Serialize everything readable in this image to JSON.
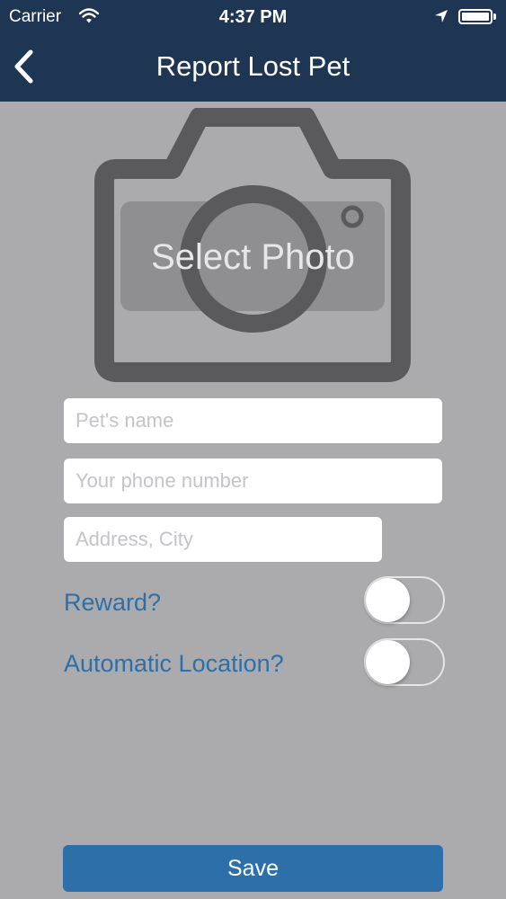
{
  "status_bar": {
    "carrier": "Carrier",
    "time": "4:37 PM"
  },
  "nav": {
    "title": "Report Lost Pet",
    "back_icon": "chevron-left-icon"
  },
  "photo": {
    "label": "Select Photo",
    "icon": "camera-icon"
  },
  "form": {
    "pet_name_placeholder": "Pet's name",
    "phone_placeholder": "Your phone number",
    "address_placeholder": "Address, City"
  },
  "toggles": {
    "reward_label": "Reward?",
    "reward_on": false,
    "auto_location_label": "Automatic Location?",
    "auto_location_on": false
  },
  "actions": {
    "save_label": "Save"
  },
  "colors": {
    "header_bg": "#1f3554",
    "body_bg": "#ababad",
    "accent": "#2d6fa8",
    "camera_stroke": "#5a595c",
    "camera_panel": "#8f8e91"
  }
}
